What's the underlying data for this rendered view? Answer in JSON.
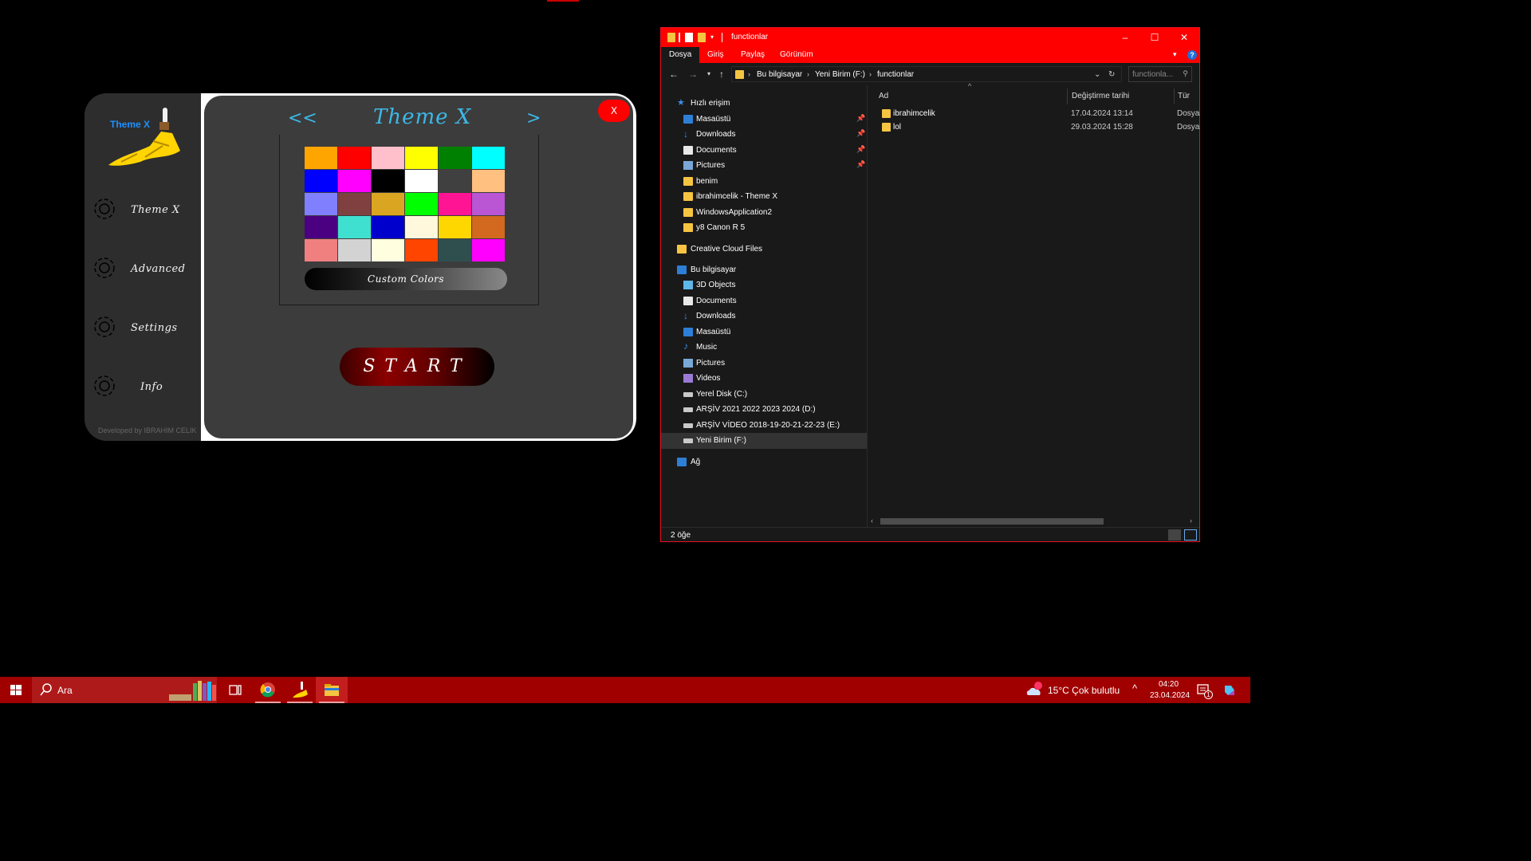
{
  "theme_app": {
    "logo_text": "Theme X",
    "title": "Theme X",
    "nav_prev": "<<",
    "nav_next": ">",
    "close_label": "X",
    "menu": [
      {
        "label": "Theme X"
      },
      {
        "label": "Advanced"
      },
      {
        "label": "Settings"
      },
      {
        "label": "Info"
      }
    ],
    "swatches": [
      "#FFA500",
      "#FF0000",
      "#FFC0CB",
      "#FFFF00",
      "#008000",
      "#00FFFF",
      "#0000FF",
      "#FF00FF",
      "#000000",
      "#FFFFFF",
      "#404040",
      "#FFC080",
      "#8080FF",
      "#804040",
      "#DAA520",
      "#00FF00",
      "#FF1493",
      "#BA55D3",
      "#4B0082",
      "#40E0D0",
      "#0000CD",
      "#FFF8DC",
      "#FFD700",
      "#D2691E",
      "#F08080",
      "#D3D3D3",
      "#FFFFE0",
      "#FF4500",
      "#2F4F4F",
      "#FF00FF"
    ],
    "custom_colors_label": "Custom Colors",
    "start_label": "START",
    "developer_credit": "Developed by IBRAHIM CELIK"
  },
  "explorer": {
    "title": "functionlar",
    "ribbon_tabs": [
      "Dosya",
      "Giriş",
      "Paylaş",
      "Görünüm"
    ],
    "breadcrumb": [
      "Bu bilgisayar",
      "Yeni Birim (F:)",
      "functionlar"
    ],
    "search_placeholder": "functionla...",
    "nav": {
      "quick_access": "Hızlı erişim",
      "quick_items": [
        "Masaüstü",
        "Downloads",
        "Documents",
        "Pictures",
        "benim",
        "ibrahimcelik - Theme X",
        "WindowsApplication2",
        "y8 Canon R 5"
      ],
      "creative_cloud": "Creative Cloud Files",
      "this_pc": "Bu bilgisayar",
      "pc_items": [
        "3D Objects",
        "Documents",
        "Downloads",
        "Masaüstü",
        "Music",
        "Pictures",
        "Videos",
        "Yerel Disk (C:)",
        "ARŞİV 2021 2022 2023 2024 (D:)",
        "ARŞİV VİDEO 2018-19-20-21-22-23  (E:)",
        "Yeni Birim (F:)"
      ],
      "network": "Ağ"
    },
    "columns": {
      "name": "Ad",
      "date": "Değiştirme tarihi",
      "type": "Tür"
    },
    "files": [
      {
        "name": "ibrahimcelik",
        "date": "17.04.2024 13:14",
        "type": "Dosya"
      },
      {
        "name": "lol",
        "date": "29.03.2024 15:28",
        "type": "Dosya"
      }
    ],
    "status": "2 öğe"
  },
  "taskbar": {
    "search_placeholder": "Ara",
    "weather": "15°C  Çok bulutlu",
    "time": "04:20",
    "date": "23.04.2024",
    "notification_count": "1"
  },
  "colors": {
    "accent_red": "#ff0000",
    "taskbar_red": "#a00000",
    "title_blue": "#3db8e8"
  }
}
